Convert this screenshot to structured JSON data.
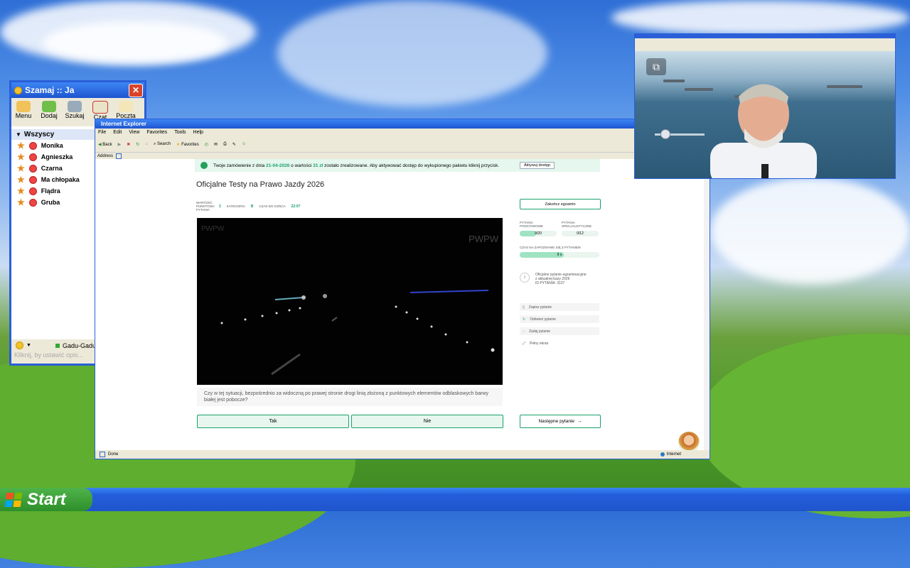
{
  "gadu": {
    "title": "Szamaj :: Ja",
    "toolbar": [
      "Menu",
      "Dodaj",
      "Szukaj",
      "Czat",
      "Poczta"
    ],
    "group": "Wszyscy",
    "contacts": [
      "Monika",
      "Agnieszka",
      "Czarna",
      "Ma chłopaka",
      "Flądra",
      "Gruba"
    ],
    "status_placeholder": "Kliknij, by ustawić opis...",
    "network": "Gadu-Gadu"
  },
  "ie": {
    "title": "Internet Explorer",
    "menu": [
      "File",
      "Edit",
      "View",
      "Favorites",
      "Tools",
      "Help"
    ],
    "back_label": "Back",
    "search_label": "Search",
    "favorites_label": "Favorites",
    "address_label": "Address",
    "status_done": "Done",
    "status_zone": "Internet"
  },
  "page": {
    "banner_pre": "Twoje zamówienie z dnia",
    "banner_date": "21-04-2026",
    "banner_mid": "o wartości",
    "banner_value": "31 zł",
    "banner_post": "zostało zrealizowane. Aby aktywować dostęp do wykupionego pakietu kliknij przycisk.",
    "activate_label": "Aktywuj dostęp",
    "title": "Oficjalne Testy na Prawo Jazdy 2026",
    "meta_value_label": "WARTOŚĆ PUNKTOWA PYTANIA",
    "meta_value": "3",
    "meta_category_label": "KATEGORIA",
    "meta_category": "B",
    "meta_time_label": "CZAS DO KOŃCA",
    "meta_time": "22:07",
    "end_exam": "Zakończ egzamin",
    "basic_label": "PYTANIA PODSTAWOWE",
    "basic_value": "9/20",
    "basic_progress": 0.45,
    "special_label": "PYTANIA SPECJALISTYCZNE",
    "special_value": "0/12",
    "special_progress": 0,
    "time_label": "CZAS NA ZAPOZNANIE SIĘ Z PYTANIEM",
    "time_value": "9 s",
    "time_progress": 0.55,
    "info_line1": "Oficjalne pytanie egzaminacyjne",
    "info_line2": "z aktualnej bazy 2026",
    "info_line3": "ID PYTANIA: 3127",
    "actions": [
      "Zapisz pytanie",
      "Odśwież pytanie",
      "Zadaj pytanie",
      "Pełny ekran"
    ],
    "video_logo_left": "PWPW",
    "video_logo_right": "PWPW",
    "question": "Czy w tej sytuacji, bezpośrednio za widoczną po prawej stronie drogi linią złożoną z punktowych elementów odblaskowych barwy białej jest pobocze?",
    "answer_yes": "Tak",
    "answer_no": "Nie",
    "next": "Następne pytanie",
    "next_arrow": "→"
  },
  "taskbar": {
    "start_label": "Start"
  }
}
